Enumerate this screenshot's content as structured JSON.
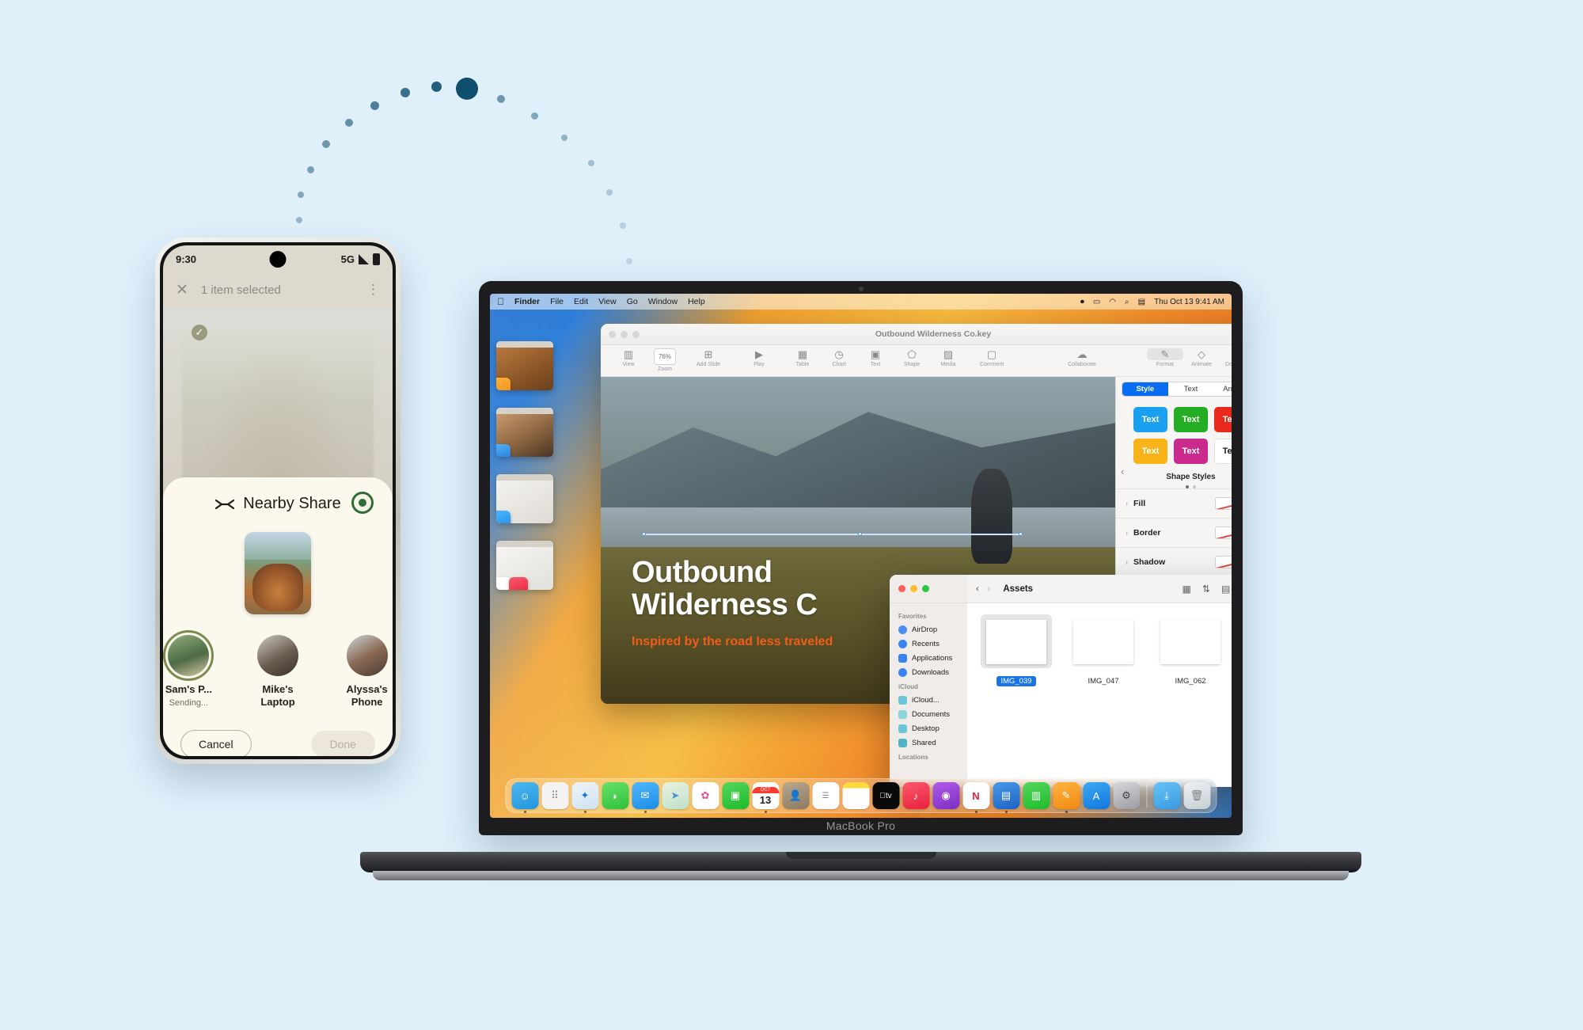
{
  "phone": {
    "status": {
      "time": "9:30",
      "network": "5G"
    },
    "appbar": {
      "close_icon": "✕",
      "title": "1 item selected",
      "overflow_icon": "⋮"
    },
    "sheet": {
      "title": "Nearby Share",
      "settings_icon": "gear-icon",
      "devices": [
        {
          "name": "Sam's P...",
          "status": "Sending...",
          "sending": true
        },
        {
          "name": "Mike's Laptop",
          "status": "",
          "sending": false
        },
        {
          "name": "Alyssa's Phone",
          "status": "",
          "sending": false
        }
      ],
      "cancel_label": "Cancel",
      "done_label": "Done"
    }
  },
  "mac": {
    "model_label": "MacBook Pro",
    "menubar": {
      "apple": "",
      "items": [
        "Finder",
        "File",
        "Edit",
        "View",
        "Go",
        "Window",
        "Help"
      ],
      "status_icons": [
        "⏺",
        "▭",
        "wifi-icon",
        "search-icon",
        "control-center-icon"
      ],
      "clock": "Thu Oct 13 9:41 AM"
    },
    "keynote": {
      "title": "Outbound Wilderness Co.key",
      "lock_icon": "🔒",
      "toolbar": [
        {
          "icon": "▥",
          "label": "View"
        },
        {
          "icon": "76%",
          "label": "Zoom",
          "pill": true
        },
        {
          "icon": "⊞",
          "label": "Add Slide"
        },
        {
          "icon": "▶",
          "label": "Play"
        },
        {
          "icon": "▦",
          "label": "Table"
        },
        {
          "icon": "◷",
          "label": "Chart"
        },
        {
          "icon": "▣",
          "label": "Text"
        },
        {
          "icon": "⬠",
          "label": "Shape"
        },
        {
          "icon": "🖼",
          "label": "Media"
        },
        {
          "icon": "💬",
          "label": "Comment"
        },
        {
          "icon": "👥",
          "label": "Collaborate"
        },
        {
          "icon": "🖌",
          "label": "Format",
          "active": true
        },
        {
          "icon": "◇",
          "label": "Animate"
        },
        {
          "icon": "▣",
          "label": "Document"
        }
      ],
      "slide": {
        "title_line1": "Outbound",
        "title_line2": "Wilderness C",
        "subtitle": "Inspired by the road less traveled"
      },
      "inspector": {
        "tabs": [
          "Style",
          "Text",
          "Arrange"
        ],
        "active_tab": "Style",
        "swatches": [
          {
            "label": "Text",
            "color": "#1aa0f0"
          },
          {
            "label": "Text",
            "color": "#23ad23"
          },
          {
            "label": "Text",
            "color": "#e8291c"
          },
          {
            "label": "Text",
            "color": "#f7b318"
          },
          {
            "label": "Text",
            "color": "#c92a8c"
          },
          {
            "label": "Text",
            "color": "#ffffff"
          }
        ],
        "section_label": "Shape Styles",
        "rows": [
          "Fill",
          "Border",
          "Shadow"
        ]
      }
    },
    "finder": {
      "path": "Assets",
      "toolbar_icons": [
        "back-icon",
        "forward-icon",
        "grid-view-icon",
        "sort-icon",
        "share-icon",
        "tag-icon",
        "more-icon",
        "search-icon"
      ],
      "sidebar": [
        {
          "section": "Favorites",
          "items": [
            {
              "label": "AirDrop",
              "color": "#3a84f2"
            },
            {
              "label": "Recents",
              "color": "#3a84f2"
            },
            {
              "label": "Applications",
              "color": "#3a84f2"
            },
            {
              "label": "Downloads",
              "color": "#3a84f2"
            }
          ]
        },
        {
          "section": "iCloud",
          "items": [
            {
              "label": "iCloud...",
              "color": "#4fb3c4"
            },
            {
              "label": "Documents",
              "color": "#4fb3c4"
            },
            {
              "label": "Desktop",
              "color": "#4fb3c4"
            },
            {
              "label": "Shared",
              "color": "#4fb3c4"
            }
          ]
        },
        {
          "section": "Locations",
          "items": []
        }
      ],
      "files": [
        {
          "name": "IMG_039",
          "selected": true
        },
        {
          "name": "IMG_047",
          "selected": false
        },
        {
          "name": "IMG_062",
          "selected": false
        }
      ]
    },
    "dock": {
      "calendar_month": "OCT",
      "calendar_day": "13",
      "icons": [
        "finder-icon",
        "launchpad-icon",
        "safari-icon",
        "messages-icon",
        "mail-icon",
        "maps-icon",
        "photos-icon",
        "facetime-icon",
        "calendar-icon",
        "contacts-icon",
        "reminders-icon",
        "notes-icon",
        "appletv-icon",
        "music-icon",
        "podcasts-icon",
        "news-icon",
        "keynote-icon",
        "numbers-icon",
        "pages-icon",
        "appstore-icon",
        "settings-icon",
        "downloads-folder-icon",
        "trash-icon"
      ]
    }
  },
  "colors": {
    "background": "#dff0fb",
    "accent": "#0a6cf1",
    "arc_dot": "#0e4f6e"
  }
}
